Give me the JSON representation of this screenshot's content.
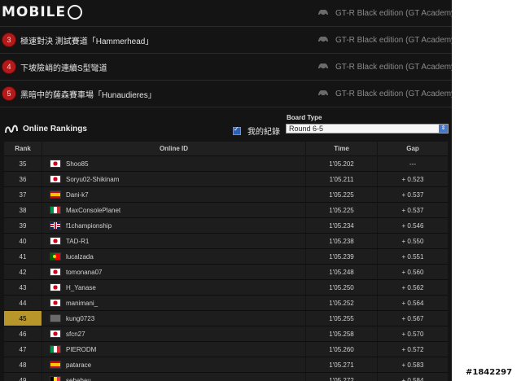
{
  "logo": {
    "text": "MOBILE"
  },
  "events": [
    {
      "badge": "",
      "title": "",
      "car": "GT-R Black edition (GT Academy) '12"
    },
    {
      "badge": "3",
      "title": "極速對決 測試賽道「Hammerhead」",
      "car": "GT-R Black edition (GT Academy) '12"
    },
    {
      "badge": "4",
      "title": "下坡險峭的連續S型彎道",
      "car": "GT-R Black edition (GT Academy) '12"
    },
    {
      "badge": "5",
      "title": "黑暗中的薩森賽車場「Hunaudieres」",
      "car": "GT-R Black edition (GT Academy) '12"
    }
  ],
  "rankings": {
    "title": "Online Rankings",
    "my_record_label": "我的紀錄",
    "my_record_checked": true,
    "board_type_label": "Board Type",
    "board_type_value": "Round 6-5",
    "columns": {
      "rank": "Rank",
      "id": "Online ID",
      "time": "Time",
      "gap": "Gap"
    },
    "highlight_rank": "45",
    "rows": [
      {
        "rank": "35",
        "flag": "jp",
        "id": "Shoo85",
        "time": "1'05.202",
        "gap": "---"
      },
      {
        "rank": "36",
        "flag": "jp",
        "id": "Soryu02-Shikinam",
        "time": "1'05.211",
        "gap": "+ 0.523"
      },
      {
        "rank": "37",
        "flag": "es",
        "id": "Dani-k7",
        "time": "1'05.225",
        "gap": "+ 0.537"
      },
      {
        "rank": "38",
        "flag": "it",
        "id": "MaxConsolePlanet",
        "time": "1'05.225",
        "gap": "+ 0.537"
      },
      {
        "rank": "39",
        "flag": "gb",
        "id": "f1championship",
        "time": "1'05.234",
        "gap": "+ 0.546"
      },
      {
        "rank": "40",
        "flag": "jp",
        "id": "TAD-R1",
        "time": "1'05.238",
        "gap": "+ 0.550"
      },
      {
        "rank": "41",
        "flag": "pt",
        "id": "lucalzada",
        "time": "1'05.239",
        "gap": "+ 0.551"
      },
      {
        "rank": "42",
        "flag": "jp",
        "id": "tomonana07",
        "time": "1'05.248",
        "gap": "+ 0.560"
      },
      {
        "rank": "43",
        "flag": "jp",
        "id": "H_Yanase",
        "time": "1'05.250",
        "gap": "+ 0.562"
      },
      {
        "rank": "44",
        "flag": "jp",
        "id": "manimani_",
        "time": "1'05.252",
        "gap": "+ 0.564"
      },
      {
        "rank": "45",
        "flag": "un",
        "id": "kung0723",
        "time": "1'05.255",
        "gap": "+ 0.567"
      },
      {
        "rank": "46",
        "flag": "jp",
        "id": "sfcn27",
        "time": "1'05.258",
        "gap": "+ 0.570"
      },
      {
        "rank": "47",
        "flag": "it",
        "id": "PIERODM",
        "time": "1'05.260",
        "gap": "+ 0.572"
      },
      {
        "rank": "48",
        "flag": "es",
        "id": "patarace",
        "time": "1'05.271",
        "gap": "+ 0.583"
      },
      {
        "rank": "49",
        "flag": "be",
        "id": "sebabau",
        "time": "1'05.272",
        "gap": "+ 0.584"
      }
    ]
  },
  "watermark": "#1842297",
  "colors": {
    "background": "#141414",
    "badge": "#b51a1a",
    "highlight": "#b8962a",
    "select_arrow": "#4a78c6"
  }
}
